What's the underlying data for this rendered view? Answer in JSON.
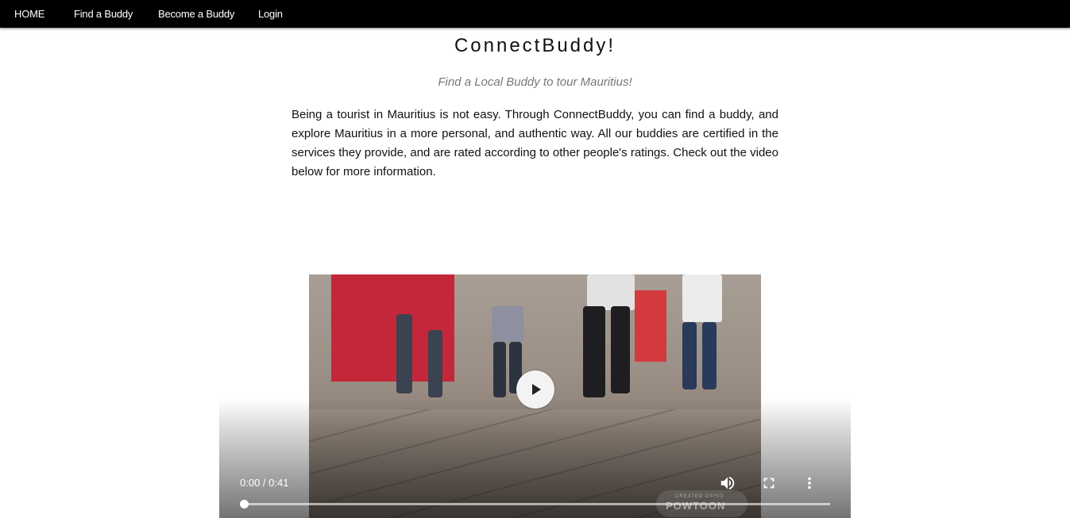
{
  "nav": {
    "items": [
      {
        "label": "HOME"
      },
      {
        "label": "Find a Buddy"
      },
      {
        "label": "Become a Buddy"
      },
      {
        "label": "Login"
      }
    ]
  },
  "hero": {
    "title": "ConnectBuddy!",
    "subtitle": "Find a Local Buddy to tour Mauritius!",
    "intro": "Being a tourist in Mauritius is not easy. Through ConnectBuddy, you can find a buddy, and explore Mauritius in a more personal, and authentic way. All our buddies are certified in the services they provide, and are rated according to other people's ratings. Check out the video below for more information."
  },
  "video": {
    "time_display": "0:00 / 0:41",
    "progress": 0,
    "watermark_small": "CREATED USING",
    "watermark_big": "POWTOON",
    "icons": [
      "play-icon",
      "volume-icon",
      "fullscreen-icon",
      "more-options-icon"
    ]
  }
}
